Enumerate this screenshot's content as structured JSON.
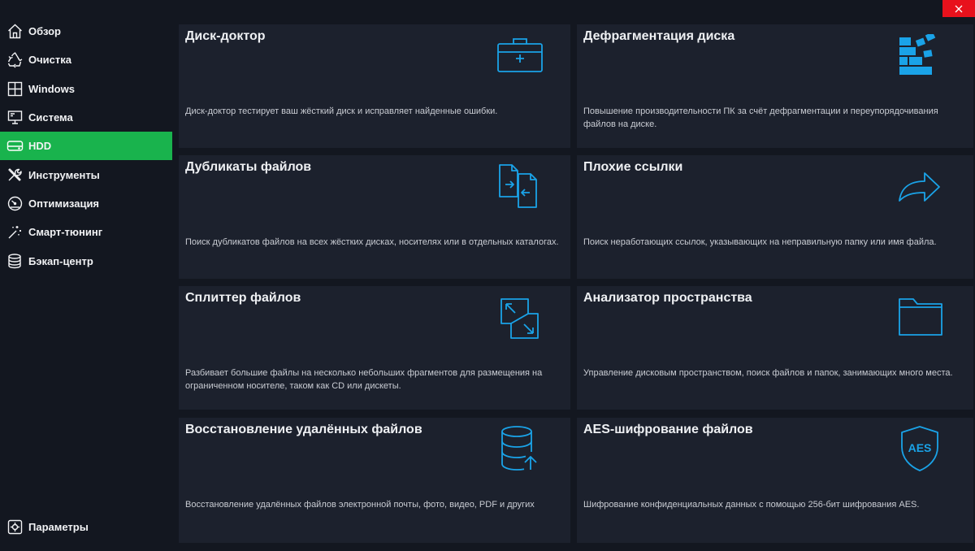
{
  "window": {
    "close_icon": "close-icon"
  },
  "sidebar": {
    "items": [
      {
        "label": "Обзор",
        "icon": "home-icon",
        "active": false
      },
      {
        "label": "Очистка",
        "icon": "recycle-icon",
        "active": false
      },
      {
        "label": "Windows",
        "icon": "windows-icon",
        "active": false
      },
      {
        "label": "Система",
        "icon": "system-icon",
        "active": false
      },
      {
        "label": "HDD",
        "icon": "hdd-icon",
        "active": true
      },
      {
        "label": "Инструменты",
        "icon": "tools-icon",
        "active": false
      },
      {
        "label": "Оптимизация",
        "icon": "gauge-icon",
        "active": false
      },
      {
        "label": "Смарт-тюнинг",
        "icon": "magic-wand-icon",
        "active": false
      },
      {
        "label": "Бэкап-центр",
        "icon": "database-icon",
        "active": false
      }
    ],
    "settings": {
      "label": "Параметры",
      "icon": "settings-icon"
    }
  },
  "colors": {
    "accent": "#19b34d",
    "icon": "#1aa3e8",
    "card_bg": "#1c212d",
    "close": "#e8111c"
  },
  "cards": [
    {
      "title": "Диск-доктор",
      "description": "Диск-доктор тестирует ваш жёсткий диск и исправляет найденные ошибки.",
      "icon": "medkit-icon"
    },
    {
      "title": "Дефрагментация диска",
      "description": "Повышение производительности ПК за счёт дефрагментации и переупорядочивания файлов на диске.",
      "icon": "defrag-icon"
    },
    {
      "title": "Дубликаты файлов",
      "description": "Поиск дубликатов файлов на всех жёстких дисках, носителях или в отдельных каталогах.",
      "icon": "duplicate-files-icon"
    },
    {
      "title": "Плохие ссылки",
      "description": "Поиск неработающих ссылок, указывающих на неправильную папку или имя файла.",
      "icon": "share-arrow-icon"
    },
    {
      "title": "Сплиттер файлов",
      "description": "Разбивает большие файлы на несколько небольших фрагментов для размещения на ограниченном носителе, таком как CD или дискеты.",
      "icon": "file-splitter-icon"
    },
    {
      "title": "Анализатор пространства",
      "description": "Управление дисковым пространством, поиск файлов и папок, занимающих много места.",
      "icon": "folder-icon"
    },
    {
      "title": "Восстановление удалённых файлов",
      "description": "Восстановление удалённых файлов электронной почты, фото, видео, PDF и других",
      "icon": "database-restore-icon"
    },
    {
      "title": "AES-шифрование файлов",
      "description": "Шифрование конфиденциальных данных с помощью 256-бит шифрования AES.",
      "icon": "aes-shield-icon",
      "icon_text": "AES"
    }
  ]
}
